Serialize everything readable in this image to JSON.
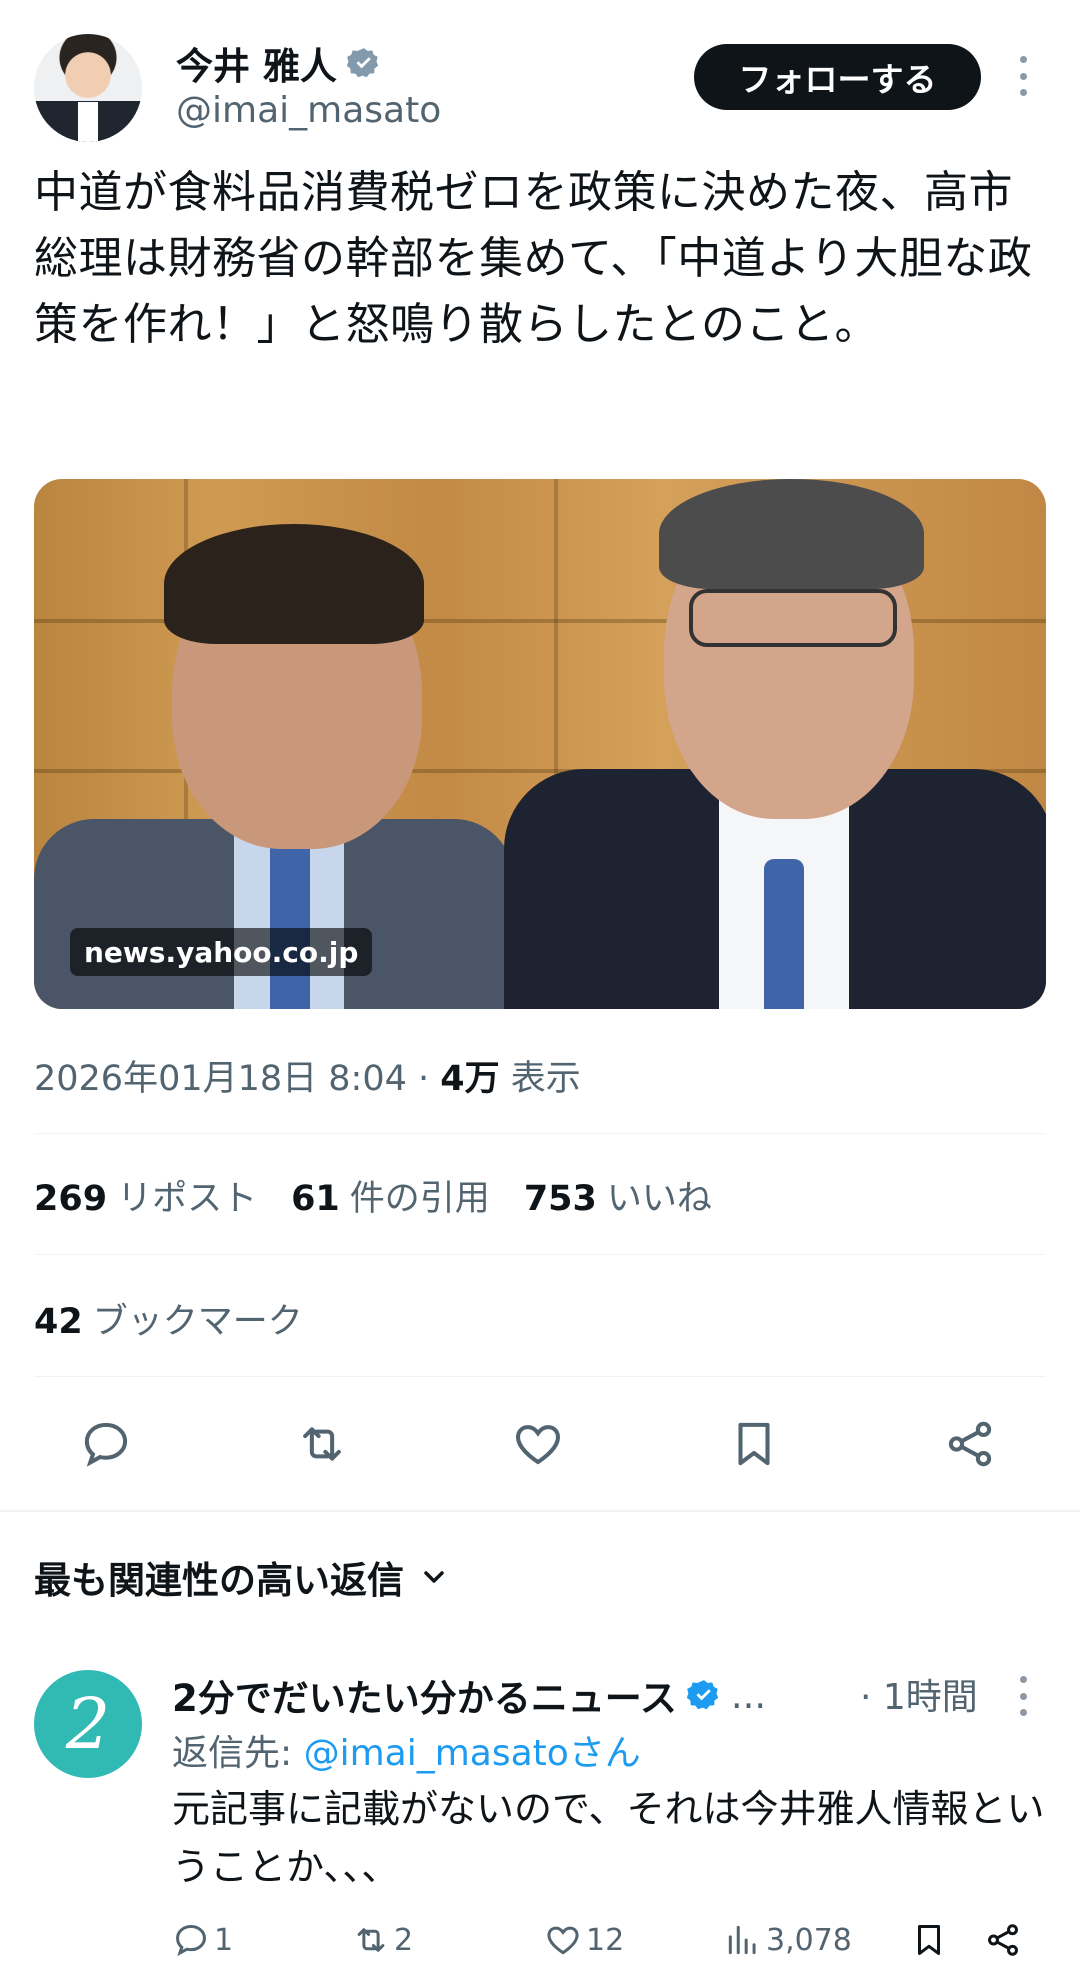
{
  "author": {
    "name": "今井 雅人",
    "handle": "@imai_masato",
    "follow_label": "フォローする"
  },
  "tweet": {
    "text": "中道が食料品消費税ゼロを政策に決めた夜、高市総理は財務省の幹部を集めて、「中道より大胆な政策を作れ！」と怒鳴り散らしたとのこと。",
    "media_source": "news.yahoo.co.jp",
    "timestamp": "2026年01月18日 8:04",
    "views_count": "4万",
    "views_label": "表示"
  },
  "stats": {
    "reposts_count": "269",
    "reposts_label": "リポスト",
    "quotes_count": "61",
    "quotes_label": "件の引用",
    "likes_count": "753",
    "likes_label": "いいね",
    "bookmarks_count": "42",
    "bookmarks_label": "ブックマーク"
  },
  "icons": [
    "reply-icon",
    "retweet-icon",
    "like-icon",
    "bookmark-icon",
    "share-icon",
    "verified-icon",
    "more-icon",
    "views-icon",
    "chevron-down-icon"
  ],
  "colors": {
    "accent": "#1d9bf0",
    "text": "#0f1419",
    "secondary": "#536471",
    "reply_avatar": "#31b9b3"
  },
  "replies_header": "最も関連性の高い返信",
  "reply": {
    "avatar_letter": "2",
    "name": "2分でだいたい分かるニュース",
    "ellipsis": "...",
    "time": "· 1時間",
    "to_prefix": "返信先: ",
    "to_handle": "@imai_masatoさん",
    "text": "元記事に記載がないので、それは今井雅人情報ということか、、、",
    "replies": "1",
    "retweets": "2",
    "likes": "12",
    "views": "3,078"
  }
}
